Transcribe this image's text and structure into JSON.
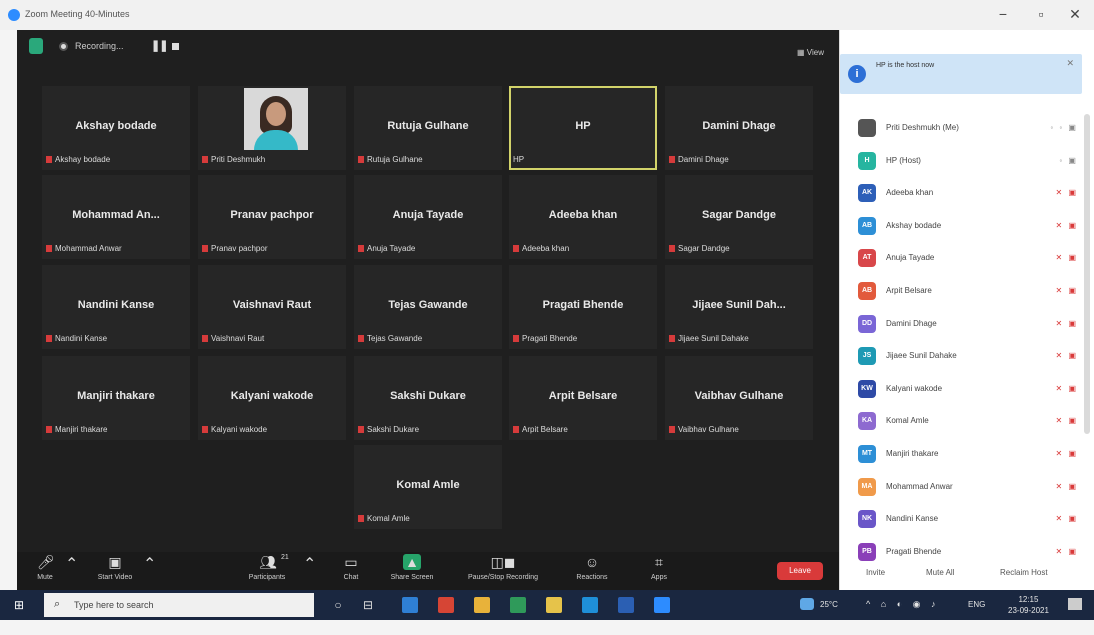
{
  "window": {
    "title": "Zoom Meeting 40-Minutes",
    "minimize_glyph": "−",
    "maximize_glyph": "▫",
    "close_glyph": "✕"
  },
  "recording": {
    "label": "Recording...",
    "pause_glyph": "❚❚"
  },
  "view_label": "▦ View",
  "tiles": [
    {
      "name": "Akshay bodade",
      "label": "Akshay bodade"
    },
    {
      "name": "",
      "label": "Priti Deshmukh",
      "has_photo": true
    },
    {
      "name": "Rutuja Gulhane",
      "label": "Rutuja Gulhane"
    },
    {
      "name": "HP",
      "label": "HP",
      "active": true
    },
    {
      "name": "Damini Dhage",
      "label": "Damini Dhage"
    },
    {
      "name": "Mohammad An...",
      "label": "Mohammad Anwar"
    },
    {
      "name": "Pranav pachpor",
      "label": "Pranav pachpor"
    },
    {
      "name": "Anuja Tayade",
      "label": "Anuja Tayade"
    },
    {
      "name": "Adeeba khan",
      "label": "Adeeba khan"
    },
    {
      "name": "Sagar Dandge",
      "label": "Sagar Dandge"
    },
    {
      "name": "Nandini Kanse",
      "label": "Nandini Kanse"
    },
    {
      "name": "Vaishnavi Raut",
      "label": "Vaishnavi Raut"
    },
    {
      "name": "Tejas Gawande",
      "label": "Tejas Gawande"
    },
    {
      "name": "Pragati Bhende",
      "label": "Pragati Bhende"
    },
    {
      "name": "Jijaee Sunil Dah...",
      "label": "Jijaee Sunil Dahake"
    },
    {
      "name": "Manjiri thakare",
      "label": "Manjiri thakare"
    },
    {
      "name": "Kalyani wakode",
      "label": "Kalyani wakode"
    },
    {
      "name": "Sakshi Dukare",
      "label": "Sakshi Dukare"
    },
    {
      "name": "Arpit Belsare",
      "label": "Arpit Belsare"
    },
    {
      "name": "Vaibhav Gulhane",
      "label": "Vaibhav Gulhane"
    },
    {
      "name": "Komal Amle",
      "label": "Komal Amle"
    }
  ],
  "toolbar": {
    "mute": "Mute",
    "start_video": "Start Video",
    "participants": "Participants",
    "participants_count": "21",
    "chat": "Chat",
    "share_screen": "Share Screen",
    "recording": "Pause/Stop Recording",
    "reactions": "Reactions",
    "apps": "Apps",
    "leave": "Leave"
  },
  "panel": {
    "notice": "HP is the host now",
    "close_glyph": "✕",
    "participants": [
      {
        "initials": "",
        "name": "Priti Deshmukh (Me)",
        "color": "#555555",
        "icons": "◦ ◦ ▣",
        "muted": false
      },
      {
        "initials": "H",
        "name": "HP (Host)",
        "color": "#26b5a0",
        "icons": "◦ ▣",
        "muted": false
      },
      {
        "initials": "AK",
        "name": "Adeeba khan",
        "color": "#2d5fb8",
        "icons": "✕ ▣",
        "muted": true
      },
      {
        "initials": "AB",
        "name": "Akshay bodade",
        "color": "#2d8fd6",
        "icons": "✕ ▣",
        "muted": true
      },
      {
        "initials": "AT",
        "name": "Anuja Tayade",
        "color": "#d8474a",
        "icons": "✕ ▣",
        "muted": true
      },
      {
        "initials": "AB",
        "name": "Arpit Belsare",
        "color": "#e25a3c",
        "icons": "✕ ▣",
        "muted": true
      },
      {
        "initials": "DD",
        "name": "Damini Dhage",
        "color": "#7a66d6",
        "icons": "✕ ▣",
        "muted": true
      },
      {
        "initials": "JS",
        "name": "Jijaee Sunil Dahake",
        "color": "#1e9ab4",
        "icons": "✕ ▣",
        "muted": true
      },
      {
        "initials": "KW",
        "name": "Kalyani wakode",
        "color": "#2e4aa6",
        "icons": "✕ ▣",
        "muted": true
      },
      {
        "initials": "KA",
        "name": "Komal Amle",
        "color": "#8d6ad0",
        "icons": "✕ ▣",
        "muted": true
      },
      {
        "initials": "MT",
        "name": "Manjiri thakare",
        "color": "#2d8fd6",
        "icons": "✕ ▣",
        "muted": true
      },
      {
        "initials": "MA",
        "name": "Mohammad Anwar",
        "color": "#f09a4a",
        "icons": "✕ ▣",
        "muted": true
      },
      {
        "initials": "NK",
        "name": "Nandini Kanse",
        "color": "#6a56c8",
        "icons": "✕ ▣",
        "muted": true
      },
      {
        "initials": "PB",
        "name": "Pragati Bhende",
        "color": "#8a3fb8",
        "icons": "✕ ▣",
        "muted": true
      }
    ],
    "invite": "Invite",
    "mute_all": "Mute All",
    "reclaim_host": "Reclaim Host"
  },
  "taskbar": {
    "start_glyph": "⊞",
    "search_placeholder": "Type here to search",
    "search_glyph": "⌕",
    "cortana_glyph": "○",
    "taskview_glyph": "⊟",
    "temperature": "25°C",
    "tray_icons": "^ ⌂ ◐ ◉ ♪",
    "language": "ENG",
    "time": "12:15",
    "date": "23-09-2021",
    "apps": [
      {
        "name": "edge-icon",
        "color": "#2f7fd4"
      },
      {
        "name": "office-icon",
        "color": "#d64535"
      },
      {
        "name": "chrome-icon",
        "color": "#e8b23a"
      },
      {
        "name": "sheets-icon",
        "color": "#2f9a5a"
      },
      {
        "name": "explorer-icon",
        "color": "#e6c34a"
      },
      {
        "name": "edge2-icon",
        "color": "#1f8fd8"
      },
      {
        "name": "word-icon",
        "color": "#2b5fb3"
      },
      {
        "name": "zoom-icon",
        "color": "#2d8cff"
      }
    ]
  }
}
